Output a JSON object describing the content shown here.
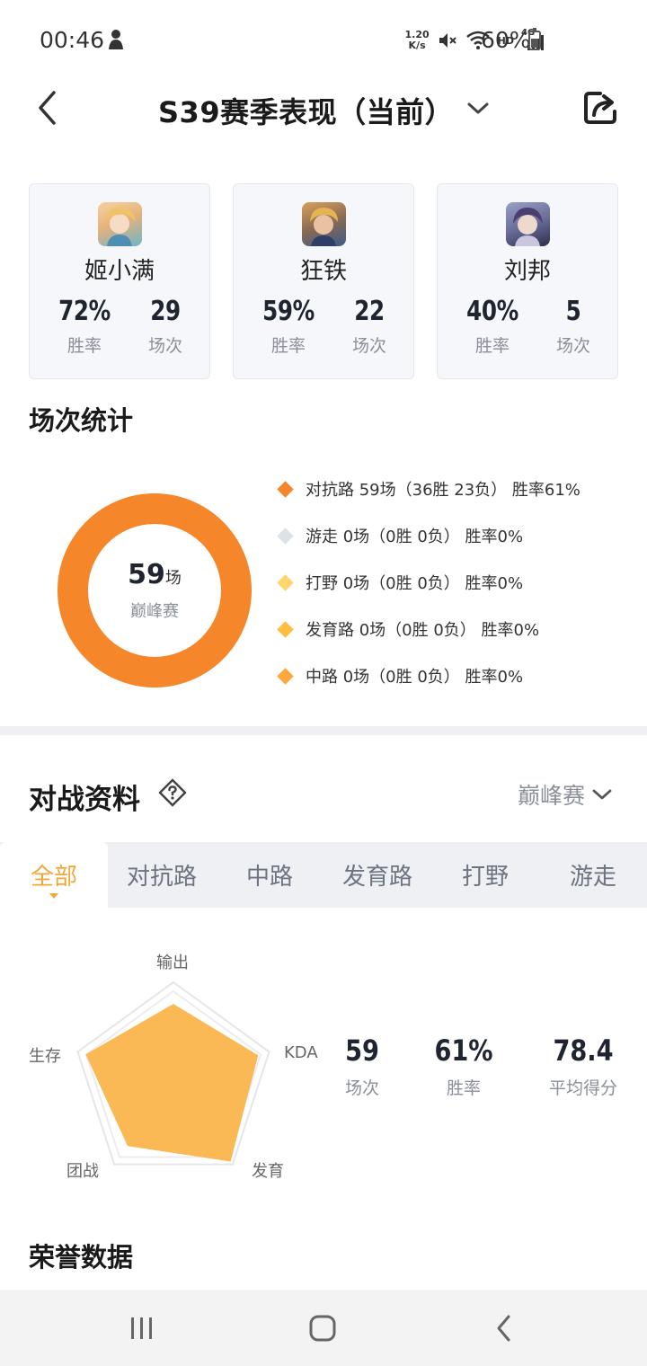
{
  "status": {
    "time": "00:46",
    "net_speed_value": "1.20",
    "net_speed_unit": "K/s",
    "hd": "HD",
    "signal": "4G",
    "battery": "60%"
  },
  "header": {
    "title": "S39赛季表现（当前）"
  },
  "heroes": [
    {
      "name": "姬小满",
      "winrate": "72%",
      "winrate_label": "胜率",
      "games": "29",
      "games_label": "场次",
      "avatar_color": "#e7b27c"
    },
    {
      "name": "狂铁",
      "winrate": "59%",
      "winrate_label": "胜率",
      "games": "22",
      "games_label": "场次",
      "avatar_color": "#8a6a52"
    },
    {
      "name": "刘邦",
      "winrate": "40%",
      "winrate_label": "胜率",
      "games": "5",
      "games_label": "场次",
      "avatar_color": "#6a6e9a"
    }
  ],
  "match_stats": {
    "title": "场次统计",
    "total": "59",
    "total_unit": "场",
    "mode_label": "巅峰赛",
    "legend": [
      {
        "text": "对抗路 59场（36胜 23负） 胜率61%",
        "color": "#f5872a",
        "games": 59
      },
      {
        "text": "游走 0场（0胜 0负） 胜率0%",
        "color": "#dde2e8",
        "games": 0
      },
      {
        "text": "打野 0场（0胜 0负） 胜率0%",
        "color": "#ffd66b",
        "games": 0
      },
      {
        "text": "发育路 0场（0胜 0负） 胜率0%",
        "color": "#ffbe3d",
        "games": 0
      },
      {
        "text": "中路 0场（0胜 0负） 胜率0%",
        "color": "#ffa63d",
        "games": 0
      }
    ]
  },
  "battle": {
    "title": "对战资料",
    "mode_select": "巅峰赛",
    "tabs": [
      "全部",
      "对抗路",
      "中路",
      "发育路",
      "打野",
      "游走"
    ],
    "active_tab": 0,
    "radar": {
      "axes": [
        "输出",
        "KDA",
        "发育",
        "团战",
        "生存"
      ],
      "values": [
        0.78,
        0.88,
        0.96,
        0.77,
        0.91
      ]
    },
    "stats": [
      {
        "value": "59",
        "label": "场次"
      },
      {
        "value": "61%",
        "label": "胜率"
      },
      {
        "value": "78.4",
        "label": "平均得分"
      }
    ]
  },
  "honor": {
    "title": "荣誉数据"
  }
}
